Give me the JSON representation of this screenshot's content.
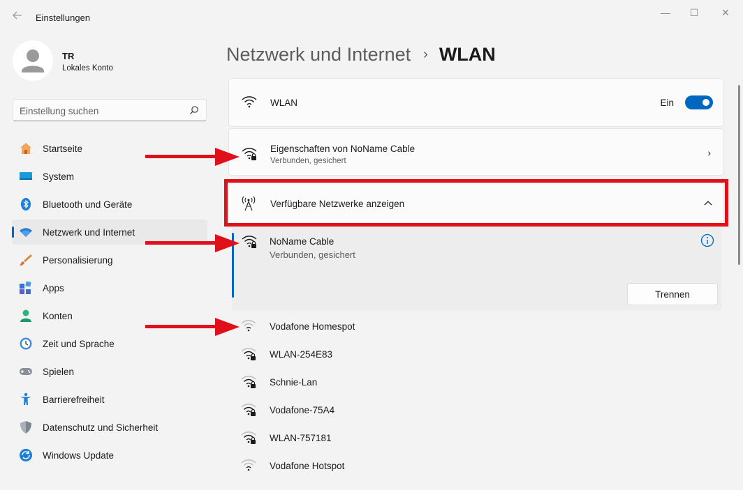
{
  "window": {
    "title": "Einstellungen",
    "controls": {
      "minimize": "—",
      "maximize": "☐",
      "close": "✕"
    }
  },
  "profile": {
    "name": "TR",
    "account_type": "Lokales Konto"
  },
  "search": {
    "placeholder": "Einstellung suchen"
  },
  "sidebar": {
    "items": [
      {
        "label": "Startseite",
        "icon": "home-icon"
      },
      {
        "label": "System",
        "icon": "monitor-icon"
      },
      {
        "label": "Bluetooth und Geräte",
        "icon": "bluetooth-icon"
      },
      {
        "label": "Netzwerk und Internet",
        "icon": "wifi-icon",
        "active": true
      },
      {
        "label": "Personalisierung",
        "icon": "brush-icon"
      },
      {
        "label": "Apps",
        "icon": "apps-icon"
      },
      {
        "label": "Konten",
        "icon": "person-icon"
      },
      {
        "label": "Zeit und Sprache",
        "icon": "clock-globe-icon"
      },
      {
        "label": "Spielen",
        "icon": "gamepad-icon"
      },
      {
        "label": "Barrierefreiheit",
        "icon": "accessibility-icon"
      },
      {
        "label": "Datenschutz und Sicherheit",
        "icon": "shield-icon"
      },
      {
        "label": "Windows Update",
        "icon": "update-icon"
      }
    ]
  },
  "breadcrumb": {
    "parent": "Netzwerk und Internet",
    "separator": "›",
    "current": "WLAN"
  },
  "wlan_toggle": {
    "label": "WLAN",
    "state_label": "Ein",
    "on": true
  },
  "properties": {
    "title": "Eigenschaften von NoName Cable",
    "subtitle": "Verbunden, gesichert"
  },
  "available": {
    "title": "Verfügbare Netzwerke anzeigen",
    "expanded": true
  },
  "connected_network": {
    "name": "NoName Cable",
    "status": "Verbunden, gesichert",
    "disconnect_label": "Trennen"
  },
  "networks": [
    {
      "name": "Vodafone Homespot",
      "secured": false
    },
    {
      "name": "WLAN-254E83",
      "secured": true
    },
    {
      "name": "Schnie-Lan",
      "secured": true
    },
    {
      "name": "Vodafone-75A4",
      "secured": true
    },
    {
      "name": "WLAN-757181",
      "secured": true
    },
    {
      "name": "Vodafone Hotspot",
      "secured": false
    }
  ],
  "colors": {
    "accent": "#0067c0",
    "annotation_red": "#e0101a"
  }
}
